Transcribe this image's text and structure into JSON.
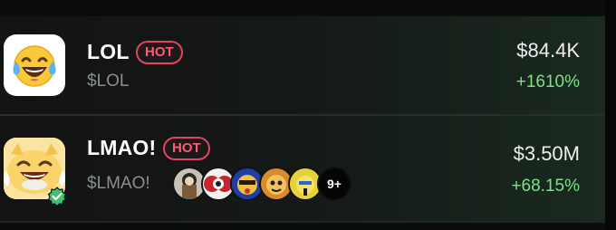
{
  "tokens": [
    {
      "name": "LOL",
      "badge": "HOT",
      "ticker": "$LOL",
      "market_cap": "$84.4K",
      "change": "+1610%",
      "icon": "laughing-tears-emoji-icon"
    },
    {
      "name": "LMAO!",
      "badge": "HOT",
      "ticker": "$LMAO!",
      "market_cap": "$3.50M",
      "change": "+68.15%",
      "icon": "laughing-cat-emoji-icon",
      "verified": true,
      "holders_more": "9+"
    }
  ],
  "colors": {
    "hot": "#e0455e",
    "positive": "#7ee08b",
    "verified": "#3fbf6f"
  }
}
